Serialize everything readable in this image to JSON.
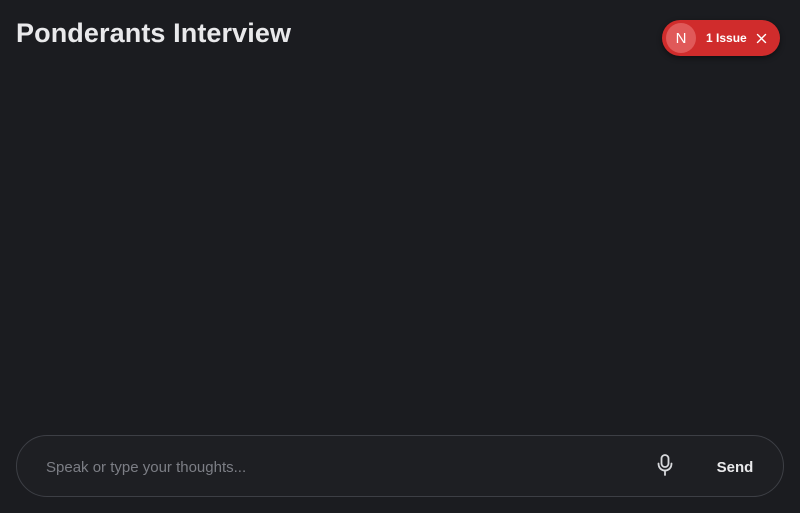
{
  "header": {
    "title": "Ponderants Interview"
  },
  "issues_indicator": {
    "badge_letter": "N",
    "label": "1 Issue",
    "close_icon": "close-icon",
    "color": "#d02c2c"
  },
  "composer": {
    "placeholder": "Speak or type your thoughts...",
    "value": "",
    "mic_icon": "microphone-icon",
    "send_label": "Send"
  },
  "colors": {
    "background": "#1b1c20",
    "input_border": "#3d3f45",
    "text": "#e9e9eb",
    "placeholder": "#7c7e85"
  }
}
